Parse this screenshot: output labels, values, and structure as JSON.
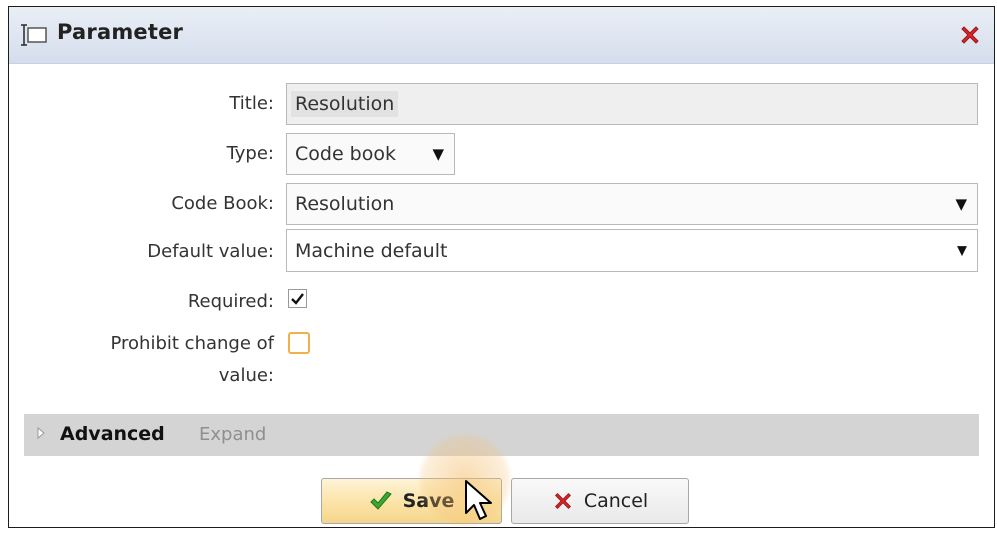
{
  "dialog": {
    "title": "Parameter",
    "icons": {
      "title": "parameter-icon",
      "close": "close-icon"
    }
  },
  "form": {
    "title": {
      "label": "Title:",
      "value": "Resolution"
    },
    "type": {
      "label": "Type:",
      "value": "Code book"
    },
    "code_book": {
      "label": "Code Book:",
      "value": "Resolution"
    },
    "default_value": {
      "label": "Default value:",
      "value": "Machine default"
    },
    "required": {
      "label": "Required:",
      "checked": true
    },
    "prohibit_change": {
      "label_line1": "Prohibit change of",
      "label_line2": "value:",
      "checked": false
    }
  },
  "advanced": {
    "title": "Advanced",
    "expand_label": "Expand"
  },
  "buttons": {
    "save_label": "Save",
    "cancel_label": "Cancel"
  },
  "colors": {
    "titlebar": "#dfe6f1",
    "save_button": "#fbe3a6",
    "checkmark_green": "#3aa832",
    "cancel_red": "#d8262b",
    "checkbox_highlight": "#f0b04a"
  }
}
